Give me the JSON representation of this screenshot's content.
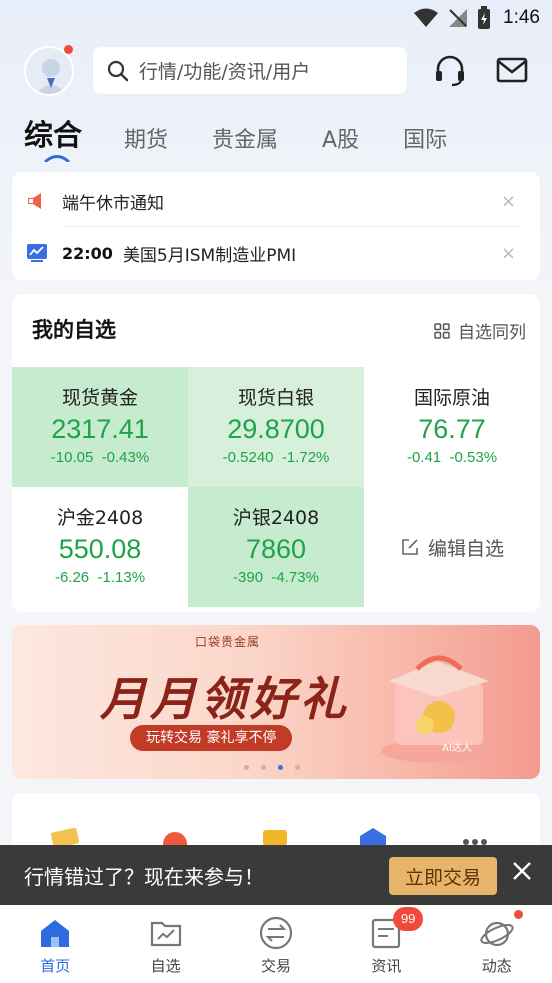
{
  "status_bar": {
    "time": "1:46"
  },
  "header": {
    "search_placeholder": "行情/功能/资讯/用户",
    "tabs": [
      {
        "label": "综合",
        "active": true
      },
      {
        "label": "期货",
        "active": false
      },
      {
        "label": "贵金属",
        "active": false
      },
      {
        "label": "A股",
        "active": false
      },
      {
        "label": "国际",
        "active": false
      }
    ]
  },
  "notices": [
    {
      "icon": "megaphone-icon",
      "time": "",
      "text": "端午休市通知",
      "close": "×"
    },
    {
      "icon": "chart-icon",
      "time": "22:00",
      "text": "美国5月ISM制造业PMI",
      "close": "×"
    }
  ],
  "watchlist": {
    "title": "我的自选",
    "side_action": "自选同列",
    "edit_label": "编辑自选",
    "items": [
      {
        "name": "现货黄金",
        "price": "2317.41",
        "change": "-10.05",
        "pct": "-0.43%"
      },
      {
        "name": "现货白银",
        "price": "29.8700",
        "change": "-0.5240",
        "pct": "-1.72%"
      },
      {
        "name": "国际原油",
        "price": "76.77",
        "change": "-0.41",
        "pct": "-0.53%"
      },
      {
        "name": "沪金2408",
        "price": "550.08",
        "change": "-6.26",
        "pct": "-1.13%"
      },
      {
        "name": "沪银2408",
        "price": "7860",
        "change": "-390",
        "pct": "-4.73%"
      }
    ],
    "colors": {
      "down": "#1fa348",
      "highlight": "#c6ebcf"
    }
  },
  "banner": {
    "brand": "口袋贵金属",
    "title": "月月领好礼",
    "subtitle": "玩转交易  豪礼享不停",
    "tag": "AI达人",
    "page_count": 4,
    "active_page": 3
  },
  "toast": {
    "text": "行情错过了？现在来参与！",
    "button": "立即交易"
  },
  "bottom_nav": [
    {
      "label": "首页",
      "icon": "home-icon",
      "active": true
    },
    {
      "label": "自选",
      "icon": "watchlist-icon",
      "active": false
    },
    {
      "label": "交易",
      "icon": "trade-icon",
      "active": false
    },
    {
      "label": "资讯",
      "icon": "news-icon",
      "active": false,
      "badge": "99"
    },
    {
      "label": "动态",
      "icon": "planet-icon",
      "active": false
    }
  ]
}
